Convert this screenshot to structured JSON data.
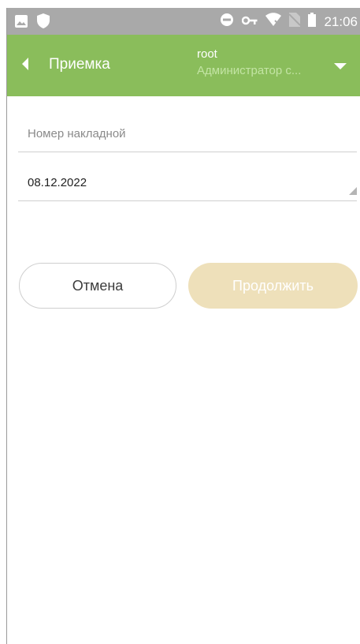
{
  "status_bar": {
    "time": "21:06",
    "left_icons": [
      "image-icon",
      "shield-icon"
    ],
    "right_icons": [
      "do-not-disturb-icon",
      "vpn-key-icon",
      "wifi-off-icon",
      "no-sim-icon",
      "battery-icon"
    ]
  },
  "app_bar": {
    "back_icon": "back-arrow-icon",
    "title": "Приемка",
    "user_name": "root",
    "user_role": "Администратор с...",
    "dropdown_icon": "dropdown-arrow-icon",
    "background_color": "#8abd5b"
  },
  "form": {
    "invoice_number": {
      "placeholder": "Номер накладной",
      "value": ""
    },
    "date": {
      "value": "08.12.2022"
    }
  },
  "buttons": {
    "cancel_label": "Отмена",
    "continue_label": "Продолжить",
    "continue_color": "#eee0ba"
  }
}
